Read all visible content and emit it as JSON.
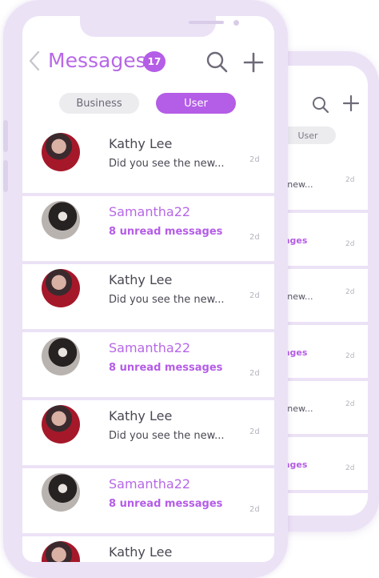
{
  "header": {
    "title": "Messages",
    "unread_badge": "17"
  },
  "tabs": [
    {
      "label": "Business",
      "active": false
    },
    {
      "label": "User",
      "active": true
    }
  ],
  "conversations": [
    {
      "name": "Kathy Lee",
      "snippet": "Did you see the new...",
      "time": "2d",
      "unread": false,
      "avatar": "red"
    },
    {
      "name": "Samantha22",
      "snippet": "8 unread messages",
      "time": "2d",
      "unread": true,
      "avatar": "bw"
    },
    {
      "name": "Kathy Lee",
      "snippet": "Did you see the new...",
      "time": "2d",
      "unread": false,
      "avatar": "red"
    },
    {
      "name": "Samantha22",
      "snippet": "8 unread messages",
      "time": "2d",
      "unread": true,
      "avatar": "bw"
    },
    {
      "name": "Kathy Lee",
      "snippet": "Did you see the new...",
      "time": "2d",
      "unread": false,
      "avatar": "red"
    },
    {
      "name": "Samantha22",
      "snippet": "8 unread messages",
      "time": "2d",
      "unread": true,
      "avatar": "bw"
    },
    {
      "name": "Kathy Lee",
      "snippet": "",
      "time": "",
      "unread": false,
      "avatar": "red"
    }
  ],
  "back_phone": {
    "tab_label": "User",
    "rows": [
      {
        "snippet": "ne new...",
        "time": "2d",
        "unread": false
      },
      {
        "snippet": "ssages",
        "time": "2d",
        "unread": true
      },
      {
        "snippet": "ne new...",
        "time": "2d",
        "unread": false
      },
      {
        "snippet": "ssages",
        "time": "2d",
        "unread": true
      },
      {
        "snippet": "ne new...",
        "time": "2d",
        "unread": false
      },
      {
        "snippet": "ssages",
        "time": "2d",
        "unread": true
      }
    ]
  },
  "colors": {
    "accent": "#b45de6",
    "phone_frame": "#ece2f6",
    "text": "#4a4752",
    "muted": "#b7b2be"
  },
  "icons": [
    "chevron-left-icon",
    "search-icon",
    "plus-icon"
  ]
}
